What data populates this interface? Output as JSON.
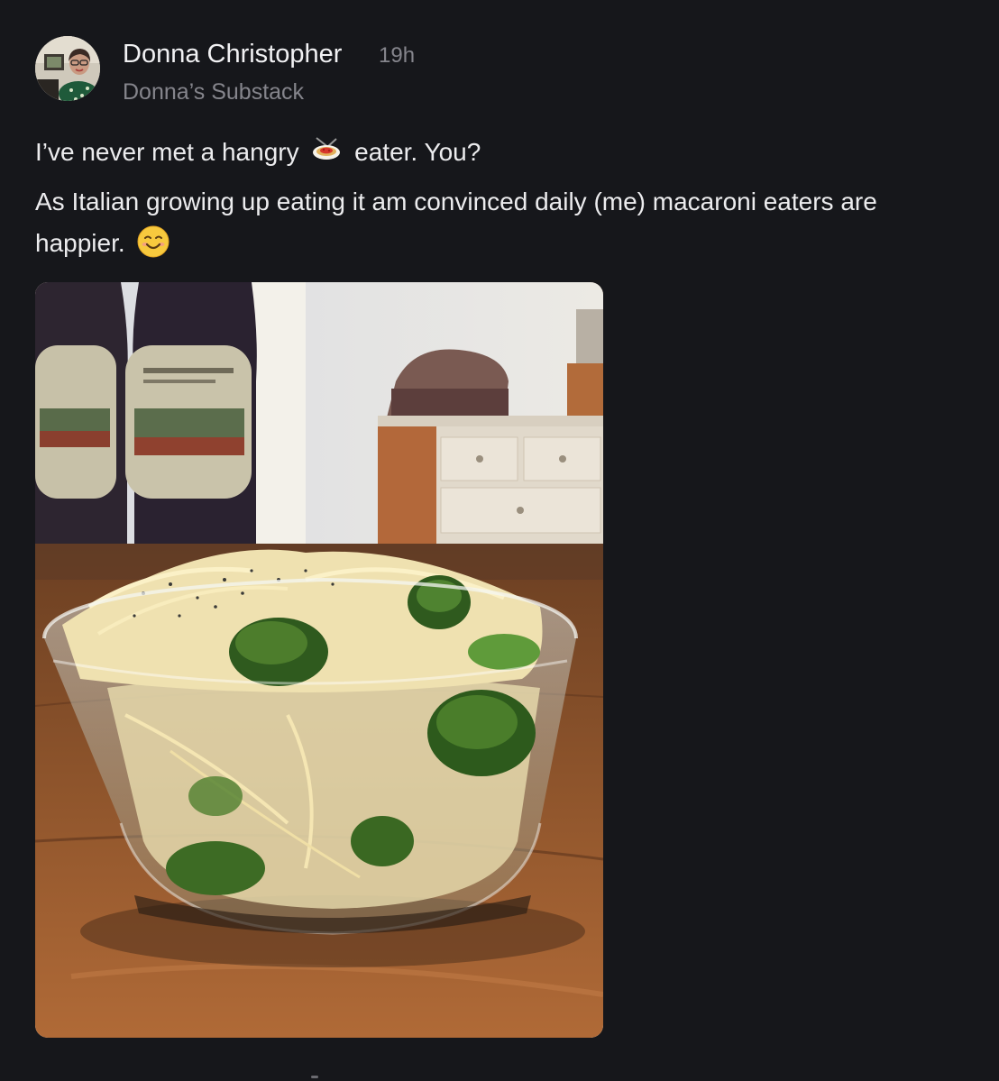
{
  "post": {
    "author": {
      "name": "Donna Christopher",
      "timestamp": "19h",
      "publication": "Donna’s Substack",
      "avatar_icon": "profile-photo"
    },
    "text": {
      "line1_before": "I’ve never met a hangry",
      "line1_emoji": "spaghetti-emoji",
      "line1_after": "eater. You?",
      "line2": "As Italian growing up eating it am convinced daily (me) macaroni eaters are",
      "line3": "happier.",
      "line3_emoji": "smiling-face-emoji"
    },
    "image": {
      "subject": "glass bowl of spaghetti with broccoli"
    }
  },
  "colors": {
    "background": "#16171b",
    "primary_text": "#ececee",
    "secondary_text": "#85858c"
  }
}
